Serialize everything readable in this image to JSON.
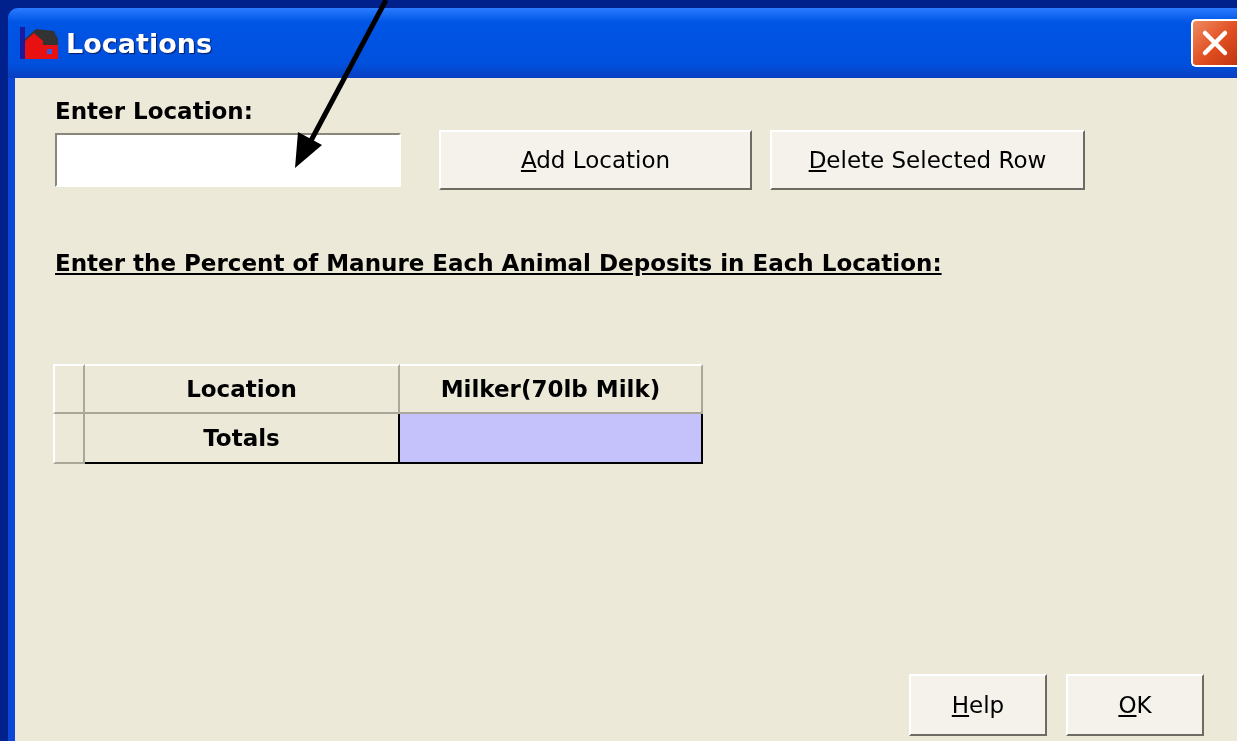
{
  "window": {
    "title": "Locations"
  },
  "location_field": {
    "label": "Enter Location:"
  },
  "buttons": [
    {
      "access_key": "A",
      "label_rest": "dd Location"
    },
    {
      "access_key": "D",
      "label_rest": "elete Selected Row"
    }
  ],
  "instruction": "Enter the Percent of Manure Each Animal Deposits in Each Location:",
  "table": {
    "columns": [
      "Location",
      "Milker(70lb Milk)"
    ],
    "rows": [
      {
        "label": "Totals"
      }
    ]
  },
  "footer_buttons": [
    {
      "access_key": "H",
      "label_rest": "elp"
    },
    {
      "access_key": "O",
      "label_rest": "K"
    }
  ]
}
